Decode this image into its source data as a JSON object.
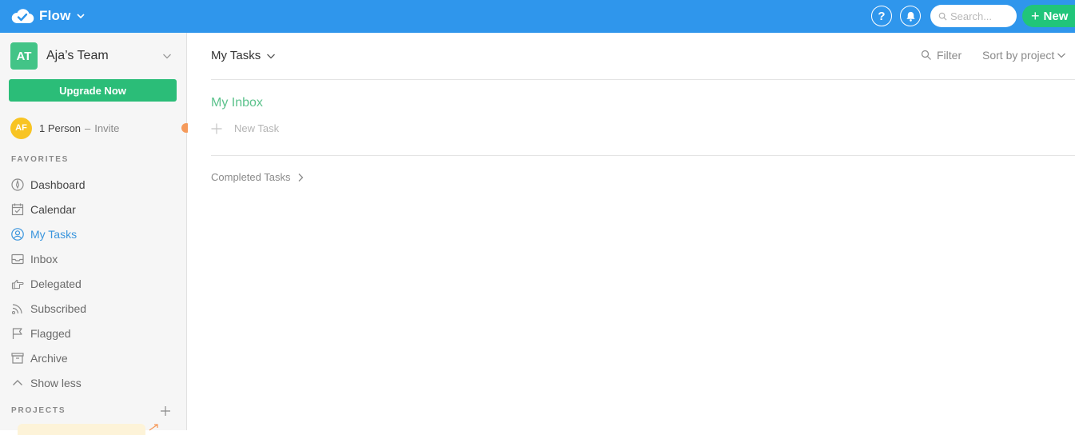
{
  "app": {
    "name": "Flow"
  },
  "header": {
    "help_label": "?",
    "search_placeholder": "Search...",
    "new_label": "New"
  },
  "sidebar": {
    "team": {
      "initials": "AT",
      "name": "Aja’s Team"
    },
    "upgrade_label": "Upgrade Now",
    "members": {
      "initials": "AF",
      "count": "1 Person",
      "separator": "–",
      "invite": "Invite"
    },
    "favorites_heading": "FAVORITES",
    "items": [
      {
        "label": "Dashboard",
        "icon": "compass-icon"
      },
      {
        "label": "Calendar",
        "icon": "calendar-icon"
      },
      {
        "label": "My Tasks",
        "icon": "user-circle-icon",
        "active": true
      },
      {
        "label": "Inbox",
        "icon": "inbox-icon"
      },
      {
        "label": "Delegated",
        "icon": "hand-point-icon"
      },
      {
        "label": "Subscribed",
        "icon": "rss-icon"
      },
      {
        "label": "Flagged",
        "icon": "flag-icon"
      },
      {
        "label": "Archive",
        "icon": "archive-icon"
      },
      {
        "label": "Show less",
        "icon": "chevron-up-icon"
      }
    ],
    "projects_heading": "PROJECTS"
  },
  "main": {
    "view_title": "My Tasks",
    "filter_label": "Filter",
    "sort_label": "Sort by project",
    "inbox_heading": "My Inbox",
    "new_task_label": "New Task",
    "completed_label": "Completed Tasks"
  },
  "colors": {
    "topbar": "#2f96ec",
    "new_button": "#21c57a",
    "upgrade": "#2bbd78",
    "team_avatar": "#43c487",
    "member_avatar": "#f8c423",
    "active_nav": "#3a95dd",
    "inbox_heading": "#5cc28c",
    "notify_dot": "#f59a5b"
  }
}
